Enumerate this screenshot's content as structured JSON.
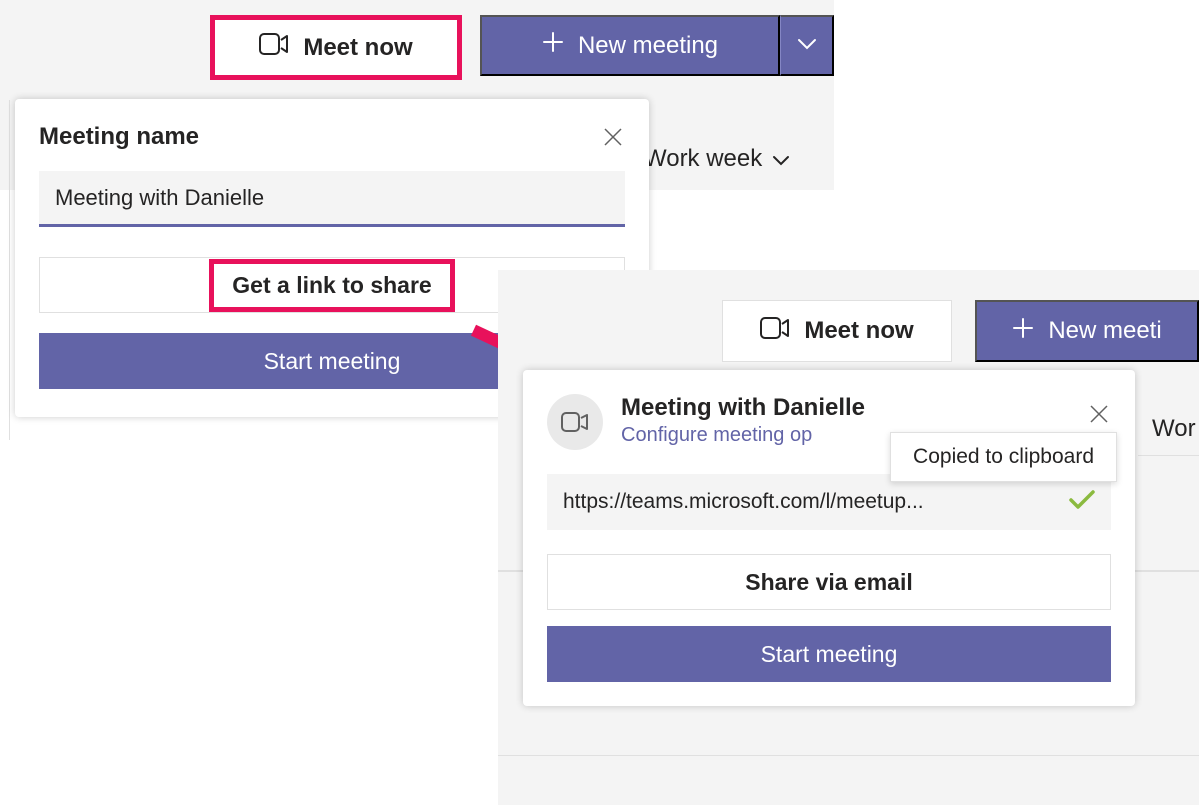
{
  "panel1": {
    "meet_now": "Meet now",
    "new_meeting": "New meeting",
    "work_week": "Work week"
  },
  "popup1": {
    "title": "Meeting name",
    "input_value": "Meeting with Danielle",
    "get_link": "Get a link to share",
    "start_meeting": "Start meeting"
  },
  "panel2": {
    "meet_now": "Meet now",
    "new_meeting": "New meeti",
    "work_week": "Wor"
  },
  "popup2": {
    "title": "Meeting with Danielle",
    "subtitle": "Configure meeting op",
    "tooltip": "Copied to clipboard",
    "link": "https://teams.microsoft.com/l/meetup...",
    "share_email": "Share via email",
    "start_meeting": "Start meeting"
  }
}
